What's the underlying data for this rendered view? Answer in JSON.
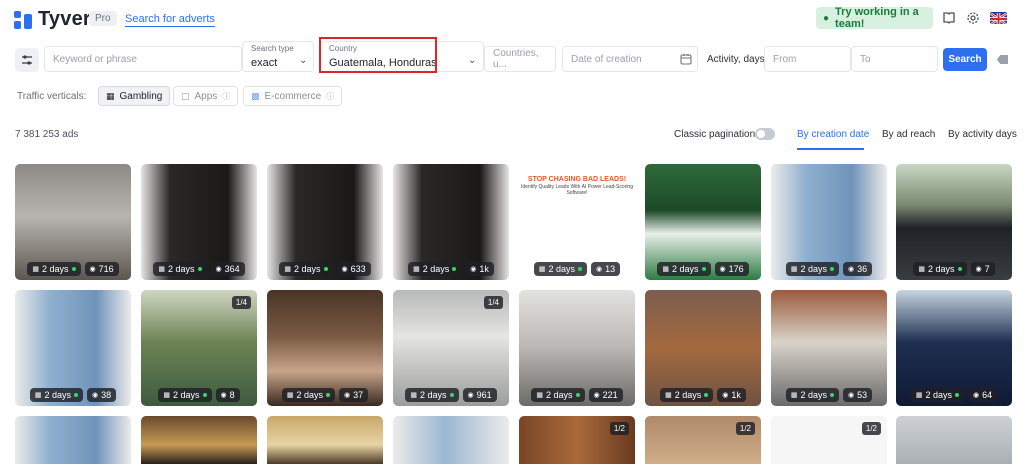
{
  "header": {
    "brand": "Tyver",
    "plan_badge": "Pro",
    "search_link": "Search for adverts",
    "team_button": "Try working in a team!"
  },
  "filters": {
    "keyword_placeholder": "Keyword or phrase",
    "search_type_label": "Search type",
    "search_type_value": "exact",
    "country_label": "Country",
    "country_value": "Guatemala, Honduras",
    "countries_placeholder": "Countries, u...",
    "date_placeholder": "Date of creation",
    "activity_label": "Activity, days",
    "from_placeholder": "From",
    "to_placeholder": "To",
    "search_button": "Search"
  },
  "verticals": {
    "label": "Traffic verticals:",
    "items": [
      {
        "label": "Gambling",
        "active": true
      },
      {
        "label": "Apps",
        "active": false
      },
      {
        "label": "E-commerce",
        "active": false
      }
    ]
  },
  "results": {
    "count": "7 381 253 ads",
    "pagination_label": "Classic pagination",
    "sort_tabs": [
      "By creation date",
      "By ad reach",
      "By activity days"
    ]
  },
  "ad_creative_text": {
    "headline": "STOP CHASING BAD LEADS!",
    "sub": "Identify Quality Leads With AI Power Lead-Scoring Software!"
  },
  "cards": [
    {
      "days": "2 days",
      "views": "716"
    },
    {
      "days": "2 days",
      "views": "364"
    },
    {
      "days": "2 days",
      "views": "633"
    },
    {
      "days": "2 days",
      "views": "1k"
    },
    {
      "days": "2 days",
      "views": "13"
    },
    {
      "days": "2 days",
      "views": "176"
    },
    {
      "days": "2 days",
      "views": "36"
    },
    {
      "days": "2 days",
      "views": "7"
    },
    {
      "days": "2 days",
      "views": "38"
    },
    {
      "days": "2 days",
      "views": "8",
      "frac": "1/4"
    },
    {
      "days": "2 days",
      "views": "37"
    },
    {
      "days": "2 days",
      "views": "961",
      "frac": "1/4"
    },
    {
      "days": "2 days",
      "views": "221"
    },
    {
      "days": "2 days",
      "views": "1k"
    },
    {
      "days": "2 days",
      "views": "53"
    },
    {
      "days": "2 days",
      "views": "64"
    }
  ],
  "row3_fracs": [
    "",
    "",
    "",
    "",
    "1/2",
    "1/2",
    "1/2",
    ""
  ]
}
